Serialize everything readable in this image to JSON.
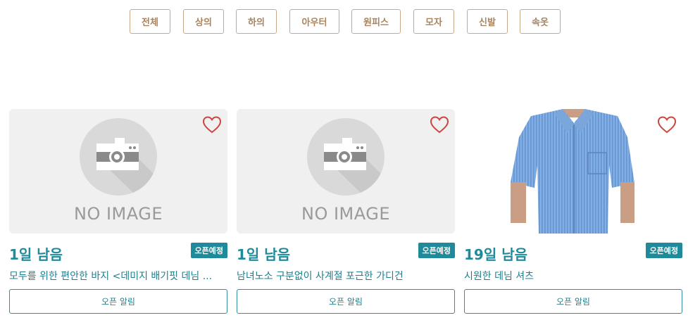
{
  "categories": [
    "전체",
    "상의",
    "하의",
    "아우터",
    "원피스",
    "모자",
    "신발",
    "속옷"
  ],
  "products": [
    {
      "image": "no-image",
      "no_image_text": "NO IMAGE",
      "days_left": "1일 남음",
      "badge": "오픈예정",
      "title": "모두를 위한 편안한 바지 <데미지 배기핏 데님 ...",
      "button": "오픈 알림"
    },
    {
      "image": "no-image",
      "no_image_text": "NO IMAGE",
      "days_left": "1일 남음",
      "badge": "오픈예정",
      "title": "남녀노소 구분없이 사계절 포근한 가디건",
      "button": "오픈 알림"
    },
    {
      "image": "photo-denim-shirt",
      "days_left": "19일 남음",
      "badge": "오픈예정",
      "title": "시원한 데님 셔츠",
      "button": "오픈 알림"
    }
  ],
  "colors": {
    "accent": "#1f8a9a",
    "category_border": "#c7a98a",
    "category_text": "#a8845f",
    "heart": "#c9463f",
    "placeholder_bg": "#f0f0f0"
  }
}
